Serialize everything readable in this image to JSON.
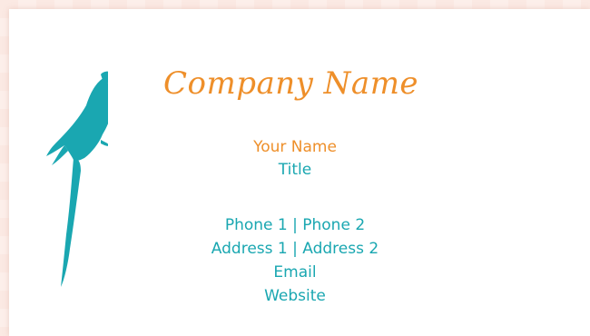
{
  "card": {
    "company_name": "Company Name",
    "your_name": "Your Name",
    "title": "Title",
    "phone_line": "Phone 1 | Phone 2",
    "address_line": "Address 1 | Address 2",
    "email": "Email",
    "website": "Website"
  },
  "colors": {
    "background": "#fbe9e3",
    "card": "#ffffff",
    "accent_orange": "#ee8f2a",
    "accent_teal": "#1aa7b1"
  },
  "icons": {
    "logo": "parrot-silhouette-icon"
  }
}
